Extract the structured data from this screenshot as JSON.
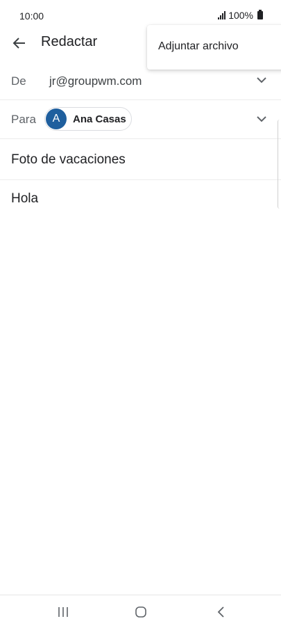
{
  "status_bar": {
    "time": "10:00",
    "battery": "100%"
  },
  "app_bar": {
    "title": "Redactar",
    "back_icon": "arrow-left-icon"
  },
  "overflow_menu": {
    "items": [
      {
        "label": "Adjuntar archivo"
      }
    ]
  },
  "compose": {
    "from_label": "De",
    "from_value": "jr@groupwm.com",
    "to_label": "Para",
    "to_recipient": {
      "initial": "A",
      "name": "Ana Casas",
      "avatar_color": "#1f5f9e"
    },
    "subject": "Foto de vacaciones",
    "body": "Hola"
  },
  "nav_bar": {
    "recents_icon": "recents-icon",
    "home_icon": "home-icon",
    "back_icon": "back-chevron-icon"
  }
}
